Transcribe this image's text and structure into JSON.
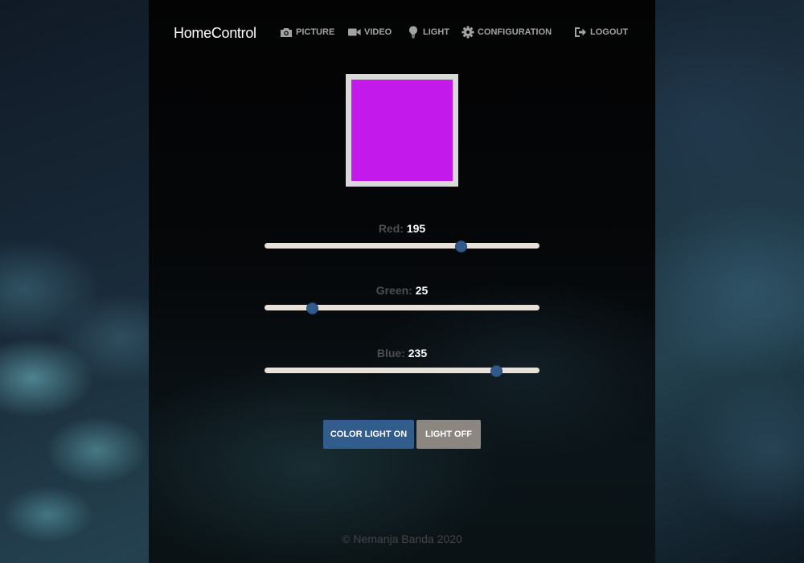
{
  "navbar": {
    "brand": "HomeControl",
    "items": [
      {
        "label": "PICTURE",
        "icon": "camera-icon"
      },
      {
        "label": "VIDEO",
        "icon": "video-camera-icon"
      },
      {
        "label": "LIGHT",
        "icon": "lightbulb-icon"
      },
      {
        "label": "CONFIGURATION",
        "icon": "gear-icon"
      }
    ],
    "logout": {
      "label": "LOGOUT",
      "icon": "logout-icon"
    }
  },
  "preview": {
    "frame_color": "#d9d9d9",
    "swatch_color": "#c319eb"
  },
  "sliders": {
    "range": [
      0,
      255
    ],
    "red": {
      "label": "Red:",
      "value": "195"
    },
    "green": {
      "label": "Green:",
      "value": "25"
    },
    "blue": {
      "label": "Blue:",
      "value": "235"
    }
  },
  "buttons": {
    "on_label": "COLOR LIGHT ON",
    "off_label": "LIGHT OFF"
  },
  "footer": {
    "text": "© Nemanja Banda 2020"
  }
}
